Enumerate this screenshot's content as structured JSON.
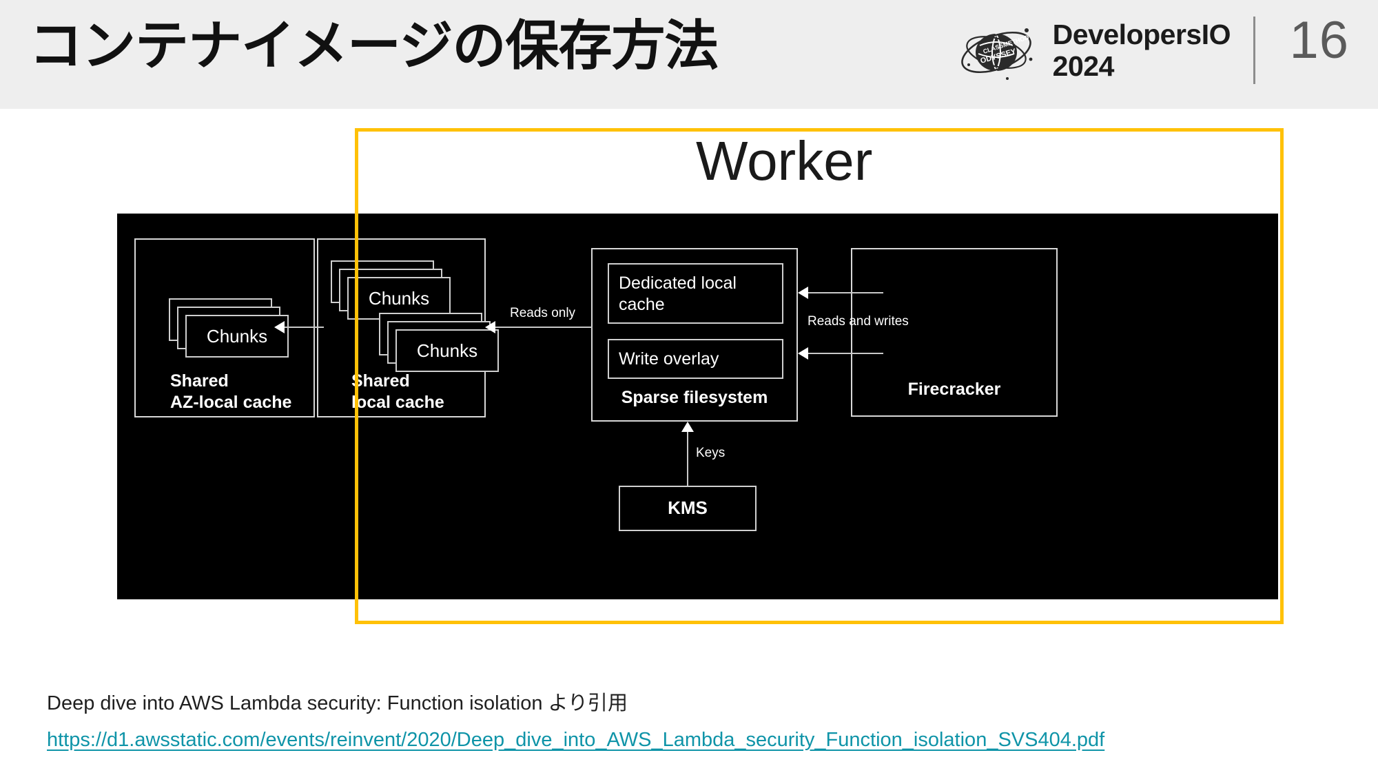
{
  "header": {
    "title": "コンテナイメージの保存方法",
    "brand_line1": "DevelopersIO",
    "brand_line2": "2024",
    "brand_logo_icon": "classmethod-odyssey-globe-logo",
    "slide_number": "16"
  },
  "figure": {
    "worker_label": "Worker",
    "accent_color": "#ffc107",
    "background_color": "#000000",
    "stroke_color": "#d8d8d8",
    "nodes": {
      "shared_az_local_cache": {
        "label": "Shared\nAZ-local cache",
        "chunks": [
          {
            "label": "Chunks"
          }
        ]
      },
      "shared_local_cache": {
        "label": "Shared\nlocal cache",
        "chunks": [
          {
            "label": "Chunks"
          },
          {
            "label": "Chunks"
          }
        ]
      },
      "sparse_filesystem": {
        "label": "Sparse filesystem",
        "children": [
          {
            "label": "Dedicated local\ncache"
          },
          {
            "label": "Write overlay"
          }
        ]
      },
      "firecracker": {
        "label": "Firecracker"
      },
      "kms": {
        "label": "KMS"
      }
    },
    "edges": [
      {
        "label": "Reads only",
        "from": "sparse_filesystem",
        "to": "shared_local_cache"
      },
      {
        "label": "Reads and writes",
        "from": "firecracker",
        "to": "sparse_filesystem"
      },
      {
        "label": "Keys",
        "from": "kms",
        "to": "sparse_filesystem"
      }
    ]
  },
  "footer": {
    "caption": "Deep dive into AWS Lambda security: Function isolation より引用",
    "link_text": "https://d1.awsstatic.com/events/reinvent/2020/Deep_dive_into_AWS_Lambda_security_Function_isolation_SVS404.pdf",
    "link_color": "#0f94a8"
  }
}
